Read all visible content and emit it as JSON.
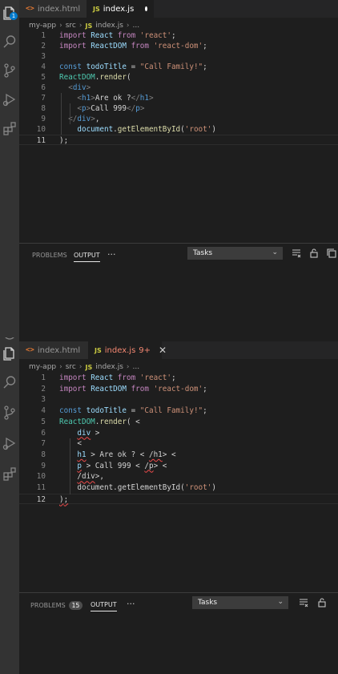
{
  "pane1": {
    "tabs": [
      {
        "label": "index.html",
        "icon": "<>"
      },
      {
        "label": "index.js",
        "icon": "JS",
        "modified": true
      }
    ],
    "breadcrumb": [
      "my-app",
      "src",
      "index.js",
      "..."
    ],
    "breadcrumb_js": "JS",
    "activity_badge": "1",
    "lines": [
      {
        "n": "1",
        "t": [
          [
            "kw",
            "import "
          ],
          [
            "id",
            "React "
          ],
          [
            "kw",
            "from "
          ],
          [
            "st",
            "'react'"
          ],
          [
            "pl",
            ";"
          ]
        ]
      },
      {
        "n": "2",
        "t": [
          [
            "kw",
            "import "
          ],
          [
            "id",
            "ReactDOM "
          ],
          [
            "kw",
            "from "
          ],
          [
            "st",
            "'react-dom'"
          ],
          [
            "pl",
            ";"
          ]
        ]
      },
      {
        "n": "3",
        "t": []
      },
      {
        "n": "4",
        "t": [
          [
            "sk",
            "const "
          ],
          [
            "id",
            "todoTitle "
          ],
          [
            "pl",
            "= "
          ],
          [
            "st",
            "\"Call Family!\""
          ],
          [
            "pl",
            ";"
          ]
        ]
      },
      {
        "n": "5",
        "t": [
          [
            "cl",
            "ReactDOM"
          ],
          [
            "pl",
            "."
          ],
          [
            "fn",
            "render"
          ],
          [
            "pl",
            "("
          ]
        ]
      },
      {
        "n": "6",
        "t": [
          [
            "pl",
            "  "
          ],
          [
            "ag",
            "<"
          ],
          [
            "tg",
            "div"
          ],
          [
            "ag",
            ">"
          ]
        ]
      },
      {
        "n": "7",
        "t": [
          [
            "pl",
            "    "
          ],
          [
            "ag",
            "<"
          ],
          [
            "tg",
            "h1"
          ],
          [
            "ag",
            ">"
          ],
          [
            "pl",
            "Are ok ?"
          ],
          [
            "ag",
            "</"
          ],
          [
            "tg",
            "h1"
          ],
          [
            "ag",
            ">"
          ]
        ]
      },
      {
        "n": "8",
        "t": [
          [
            "pl",
            "    "
          ],
          [
            "ag",
            "<"
          ],
          [
            "tg",
            "p"
          ],
          [
            "ag",
            ">"
          ],
          [
            "pl",
            "Call 999"
          ],
          [
            "ag",
            "</"
          ],
          [
            "tg",
            "p"
          ],
          [
            "ag",
            ">"
          ]
        ]
      },
      {
        "n": "9",
        "t": [
          [
            "pl",
            "  "
          ],
          [
            "ag",
            "</"
          ],
          [
            "tg",
            "div"
          ],
          [
            "ag",
            ">"
          ],
          [
            "pl",
            ","
          ]
        ]
      },
      {
        "n": "10",
        "t": [
          [
            "pl",
            "    "
          ],
          [
            "id",
            "document"
          ],
          [
            "pl",
            "."
          ],
          [
            "fn",
            "getElementById"
          ],
          [
            "pl",
            "("
          ],
          [
            "st",
            "'root'"
          ],
          [
            "pl",
            ")"
          ]
        ]
      },
      {
        "n": "11",
        "t": [
          [
            "pl",
            ");"
          ]
        ],
        "current": true
      }
    ],
    "panel": {
      "problems": "PROBLEMS",
      "output": "OUTPUT",
      "more": "···",
      "select": "Tasks"
    }
  },
  "pane2": {
    "tabs": [
      {
        "label": "index.html",
        "icon": "<>"
      },
      {
        "label": "index.js",
        "icon": "JS",
        "errors": "9+",
        "close": "✕"
      }
    ],
    "breadcrumb": [
      "my-app",
      "src",
      "index.js",
      "..."
    ],
    "breadcrumb_js": "JS",
    "lines": [
      {
        "n": "1",
        "t": [
          [
            "kw",
            "import "
          ],
          [
            "id",
            "React "
          ],
          [
            "kw",
            "from "
          ],
          [
            "st",
            "'react'"
          ],
          [
            "pl",
            ";"
          ]
        ]
      },
      {
        "n": "2",
        "t": [
          [
            "kw",
            "import "
          ],
          [
            "id",
            "ReactDOM "
          ],
          [
            "kw",
            "from "
          ],
          [
            "st",
            "'react-dom'"
          ],
          [
            "pl",
            ";"
          ]
        ]
      },
      {
        "n": "3",
        "t": []
      },
      {
        "n": "4",
        "t": [
          [
            "sk",
            "const "
          ],
          [
            "id",
            "todoTitle "
          ],
          [
            "pl",
            "= "
          ],
          [
            "st",
            "\"Call Family!\""
          ],
          [
            "pl",
            ";"
          ]
        ]
      },
      {
        "n": "5",
        "t": [
          [
            "cl",
            "ReactDOM"
          ],
          [
            "pl",
            "."
          ],
          [
            "fn",
            "render"
          ],
          [
            "pl",
            "( <"
          ]
        ]
      },
      {
        "n": "6",
        "t": [
          [
            "pl",
            "    "
          ],
          [
            "id sq",
            "div"
          ],
          [
            "pl",
            " >"
          ]
        ]
      },
      {
        "n": "7",
        "t": [
          [
            "pl",
            "    <"
          ]
        ]
      },
      {
        "n": "8",
        "t": [
          [
            "pl",
            "    "
          ],
          [
            "id sq",
            "h1"
          ],
          [
            "pl",
            " > Are ok ? < "
          ],
          [
            "pl sq",
            "/h1"
          ],
          [
            "pl",
            "> <"
          ]
        ]
      },
      {
        "n": "9",
        "t": [
          [
            "pl",
            "    "
          ],
          [
            "id sq",
            "p"
          ],
          [
            "pl",
            " > Call 999 < "
          ],
          [
            "pl sq",
            "/p"
          ],
          [
            "pl",
            "> <"
          ]
        ]
      },
      {
        "n": "10",
        "t": [
          [
            "pl",
            "    "
          ],
          [
            "pl sq",
            "/div"
          ],
          [
            "pl",
            ">,"
          ]
        ]
      },
      {
        "n": "11",
        "t": [
          [
            "pl",
            "    "
          ],
          [
            "pl",
            "document."
          ],
          [
            "pl",
            "getElementById("
          ],
          [
            "st",
            "'root'"
          ],
          [
            "pl",
            ")"
          ]
        ]
      },
      {
        "n": "12",
        "t": [
          [
            "pl sq",
            ")"
          ],
          [
            "pl sq",
            ";"
          ]
        ],
        "current": true
      }
    ],
    "panel": {
      "problems": "PROBLEMS",
      "problems_count": "15",
      "output": "OUTPUT",
      "more": "···",
      "select": "Tasks"
    }
  }
}
